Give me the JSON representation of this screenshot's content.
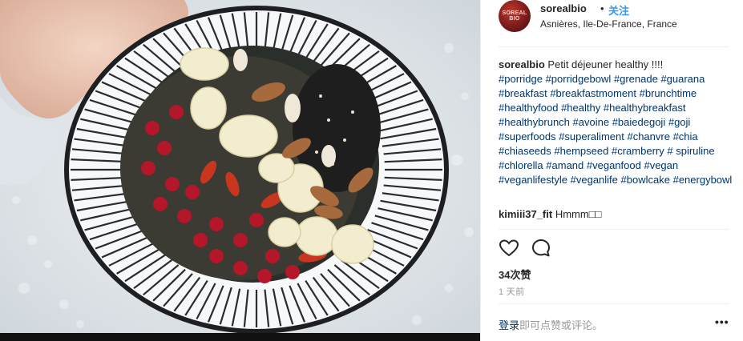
{
  "post": {
    "author": "sorealbio",
    "avatar_text": "SOREAL BIO",
    "dot": "•",
    "follow_label": "关注",
    "location": "Asnières, Ile-De-France, France",
    "caption_text": "Petit déjeuner healthy !!!!",
    "hashtags": [
      "#porridge",
      "#porridgebowl",
      "#grenade",
      "#guarana",
      "#breakfast",
      "#breakfastmoment",
      "#brunchtime",
      "#healthyfood",
      "#healthy",
      "#healthybreakfast",
      "#healthybrunch",
      "#avoine",
      "#baiedegoji",
      "#goji",
      "#superfoods",
      "#superaliment",
      "#chanvre",
      "#chia",
      "#chiaseeds",
      "#hempseed",
      "#cramberry",
      "#",
      "spiruline",
      "#chlorella",
      "#amand",
      "#veganfood",
      "#vegan",
      "#veganlifestyle",
      "#veganlife",
      "#bowlcake",
      "#energybowl"
    ],
    "comment": {
      "user": "kimiii37_fit",
      "text": "Hmmm□□"
    },
    "likes": "34次赞",
    "time_ago": "1 天前",
    "login_link": "登录",
    "login_suffix": "即可点赞或评论。",
    "more_label": "•••"
  },
  "icons": {
    "like": "heart-icon",
    "comment": "comment-icon",
    "more": "more-options-icon"
  },
  "colors": {
    "link_blue": "#3897f0",
    "hashtag": "#003569",
    "muted": "#999999",
    "text": "#262626"
  }
}
